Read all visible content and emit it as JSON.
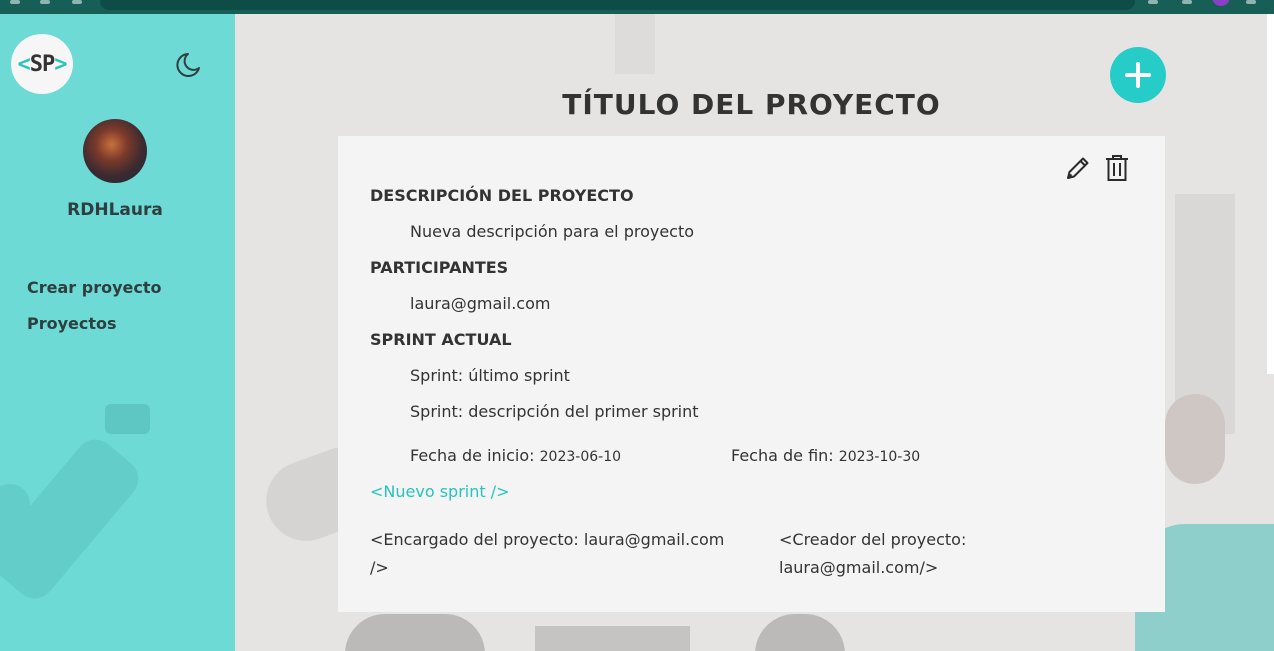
{
  "app": {
    "logo_left": "<",
    "logo_text": "SP",
    "logo_right": ">",
    "accent": "#26c4bd",
    "sidebar_color": "#6edad6"
  },
  "sidebar": {
    "username": "RDHLaura",
    "items": [
      {
        "label": "Crear proyecto"
      },
      {
        "label": "Proyectos"
      }
    ]
  },
  "project": {
    "title": "TÍTULO DEL PROYECTO",
    "description_heading": "DESCRIPCIÓN DEL PROYECTO",
    "description": "Nueva descripción para el proyecto",
    "participants_heading": "PARTICIPANTES",
    "participants": [
      "laura@gmail.com"
    ],
    "sprint_heading": "SPRINT ACTUAL",
    "sprint_name": "Sprint: último sprint",
    "sprint_description": "Sprint: descripción del primer sprint",
    "start_label": "Fecha de inicio:",
    "start_date": "2023-06-10",
    "end_label": "Fecha de fin:",
    "end_date": "2023-10-30",
    "new_sprint_link": "<Nuevo sprint />",
    "manager_line1": "<Encargado del proyecto: laura@gmail.com",
    "manager_line2": "/>",
    "creator_line1": "<Creador del proyecto:",
    "creator_line2": "laura@gmail.com/>"
  },
  "icons": {
    "theme": "moon-icon",
    "add": "plus-icon",
    "edit": "pencil-icon",
    "delete": "trash-icon"
  }
}
